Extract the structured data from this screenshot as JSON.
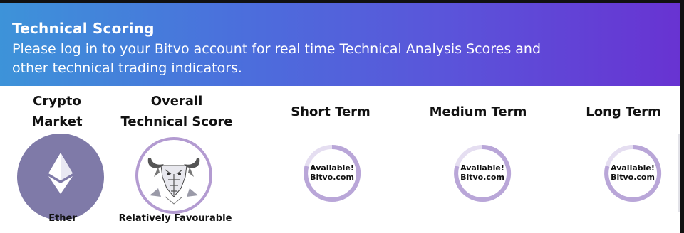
{
  "banner": {
    "title": "Technical Scoring",
    "text_line1": "Please log in to your Bitvo account for real time Technical Analysis Scores and",
    "text_line2": "other technical trading indicators."
  },
  "columns": {
    "crypto_market_line1": "Crypto",
    "crypto_market_line2": "Market",
    "overall_line1": "Overall",
    "overall_line2": "Technical Score",
    "short_term": "Short Term",
    "medium_term": "Medium Term",
    "long_term": "Long Term"
  },
  "crypto": {
    "name": "Ether",
    "icon": "ethereum-icon",
    "circle_color": "#7f7aa8"
  },
  "overall": {
    "label": "Relatively Favourable",
    "icon": "bull-icon",
    "ring_color": "#b39bd1"
  },
  "terms": [
    {
      "name": "Short Term",
      "line1": "Available!",
      "line2": "Bitvo.com"
    },
    {
      "name": "Medium Term",
      "line1": "Available!",
      "line2": "Bitvo.com"
    },
    {
      "name": "Long Term",
      "line1": "Available!",
      "line2": "Bitvo.com"
    }
  ],
  "colors": {
    "banner_gradient_start": "#3d93d9",
    "banner_gradient_end": "#6833d2",
    "badge_ring": "#b9a6d8",
    "badge_ring_faint": "#e5def1"
  }
}
